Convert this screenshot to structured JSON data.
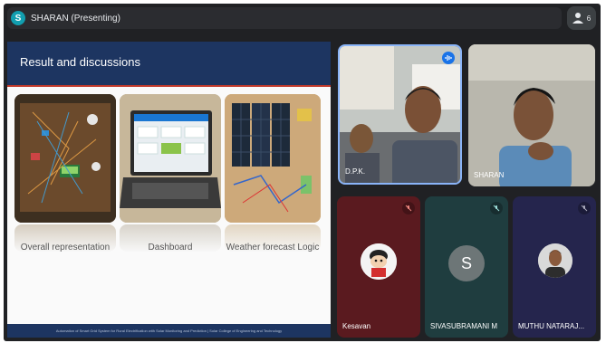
{
  "presenter": {
    "initial": "S",
    "label": "SHARAN (Presenting)"
  },
  "participants": {
    "count": "6"
  },
  "slide": {
    "title": "Result and discussions",
    "captions": [
      "Overall representation",
      "Dashboard",
      "Weather forecast Logic"
    ],
    "footer": "Automation of Smart Grid System for Rural Electrification with Solar Monitoring and Prediction | Solar College of Engineering and Technology"
  },
  "tiles": [
    {
      "name": "D.P.K.",
      "bg": "#3a3f47"
    },
    {
      "name": "SHARAN",
      "bg": "#8a8d8f"
    },
    {
      "name": "Kesavan",
      "bg": "#5a1a1f",
      "muted": true
    },
    {
      "name": "SIVASUBRAMANI M",
      "initial": "S",
      "bg": "#1f3d3f",
      "muted": true
    },
    {
      "name": "MUTHU NATARAJ...",
      "bg": "#25254d",
      "muted": true
    }
  ],
  "colors": {
    "bg": "#202124",
    "slide_header": "#1d3561",
    "accent_red": "#c0392b"
  },
  "icons": [
    "people-icon",
    "audio-wave-icon",
    "mic-off-icon"
  ]
}
